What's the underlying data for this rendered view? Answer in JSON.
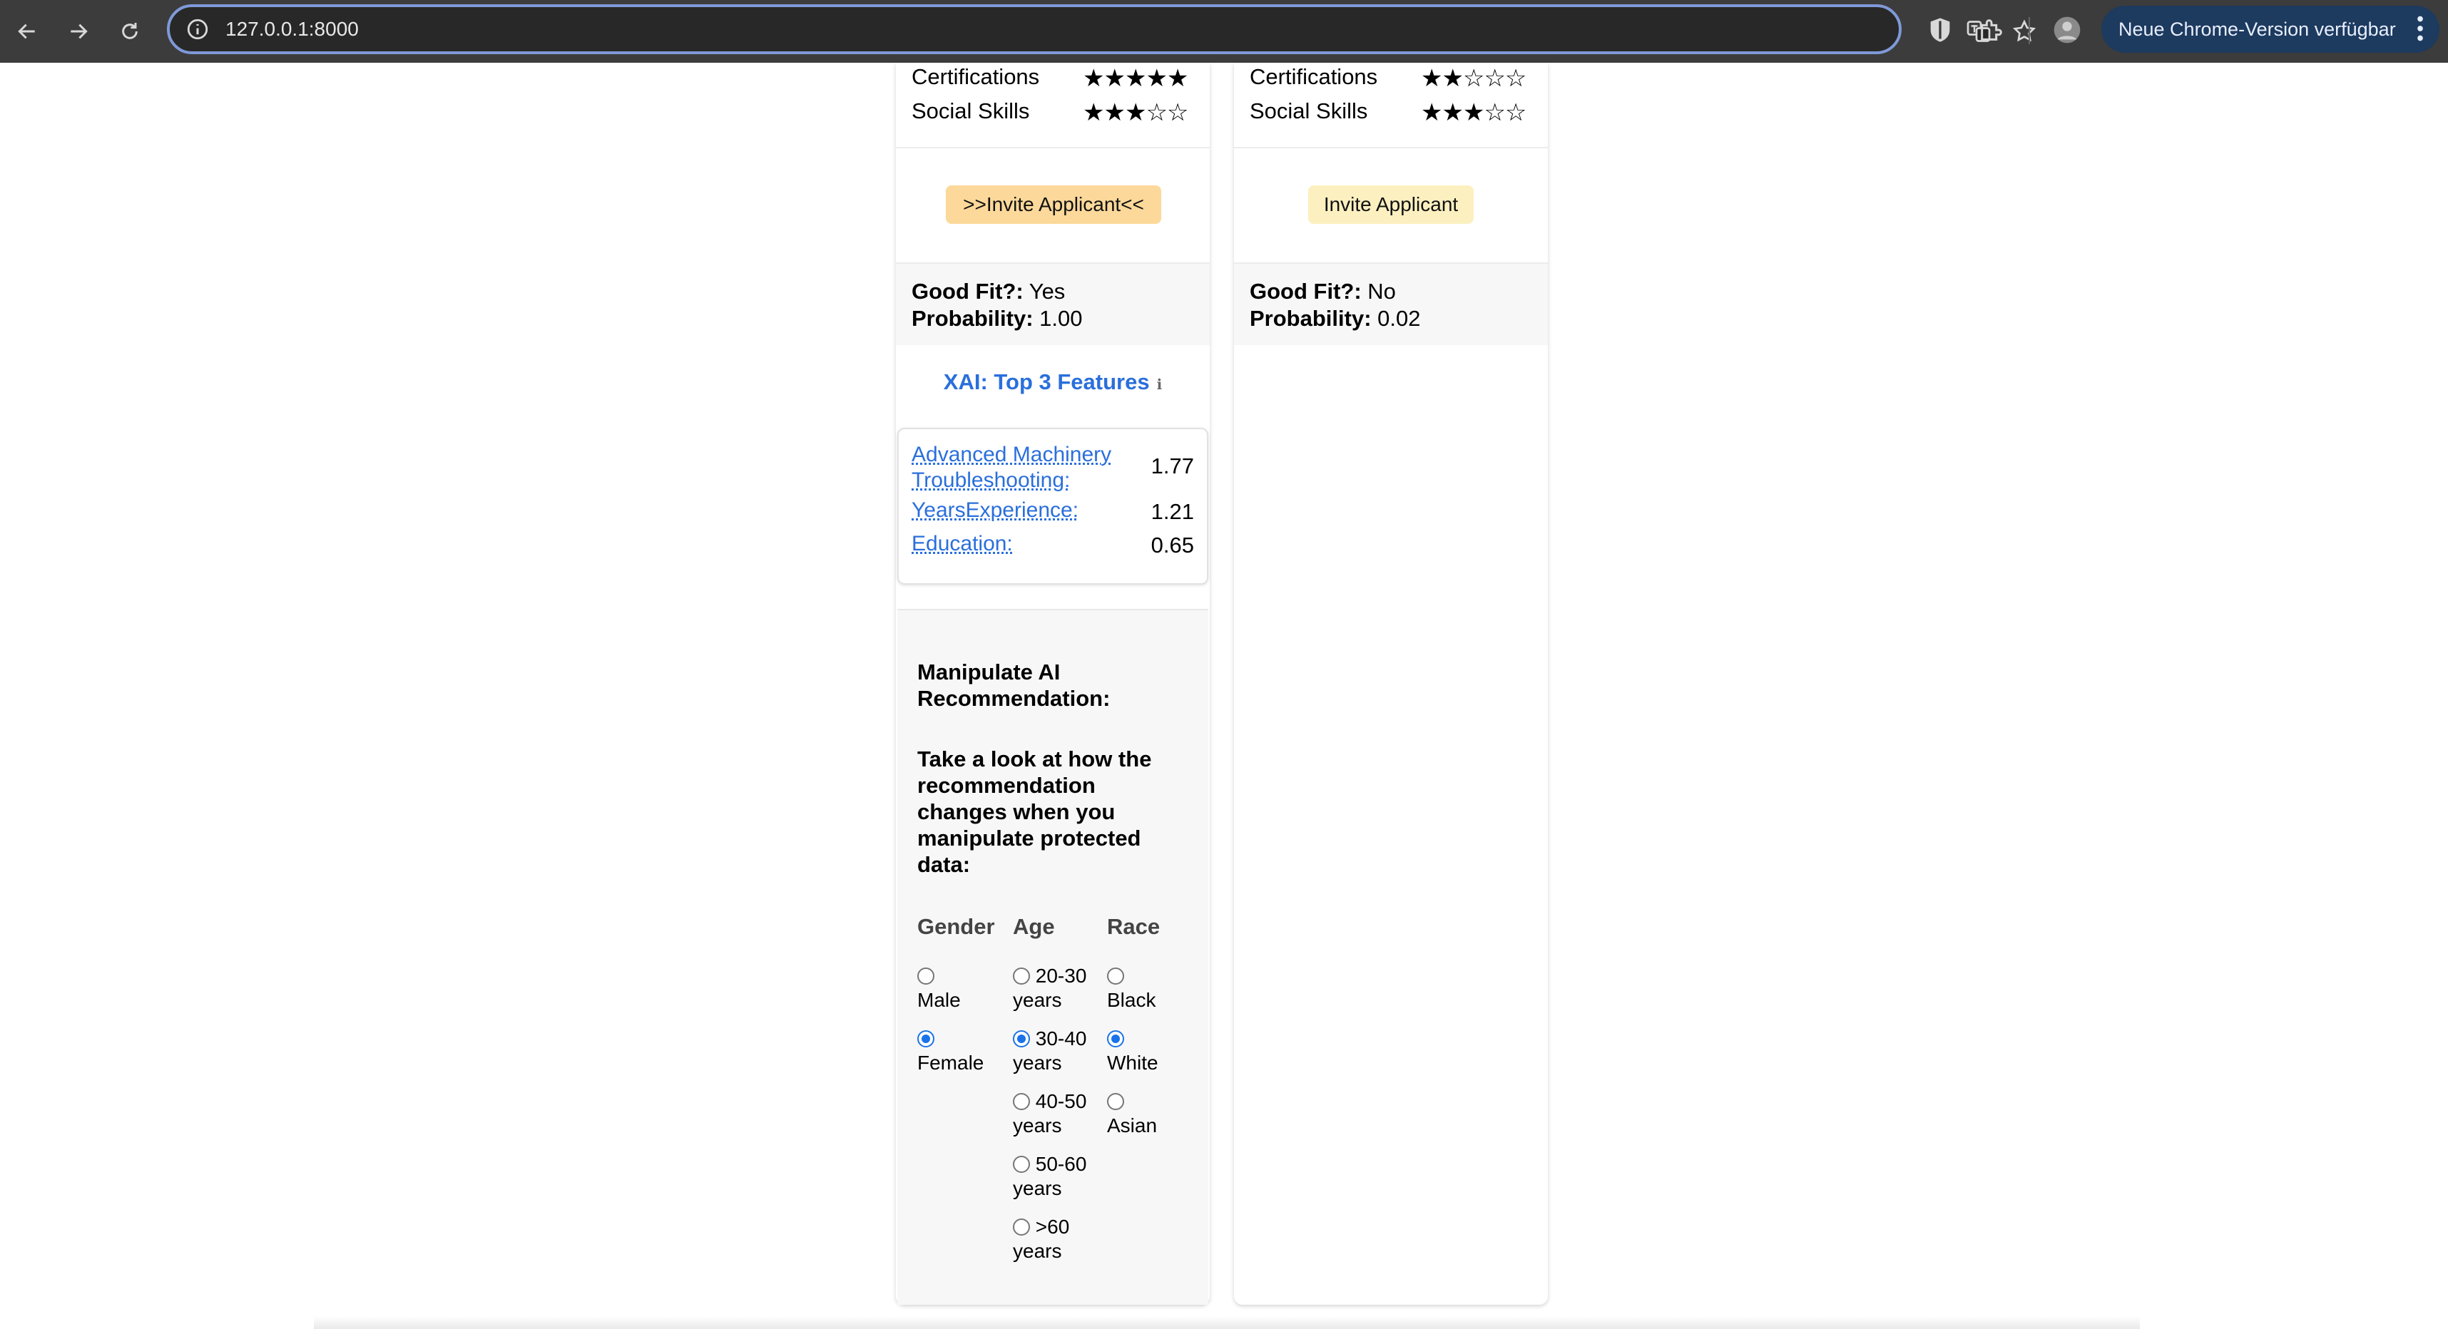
{
  "browser": {
    "url": "127.0.0.1:8000",
    "update_label": "Neue Chrome-Version verfügbar"
  },
  "left_card": {
    "skills": [
      {
        "label": "Certifications",
        "stars": "★★★★★",
        "rating": 5
      },
      {
        "label": "Social Skills",
        "stars": "★★★☆☆",
        "rating": 3
      }
    ],
    "invite_label": ">>Invite Applicant<<",
    "good_fit_label": "Good Fit?:",
    "good_fit_value": "Yes",
    "probability_label": "Probability:",
    "probability_value": "1.00",
    "xai_title": "XAI: Top 3 Features",
    "xai_info": "ℹ",
    "features": [
      {
        "name": "Advanced Machinery Troubleshooting:",
        "value": "1.77"
      },
      {
        "name": "YearsExperience:",
        "value": "1.21"
      },
      {
        "name": "Education:",
        "value": "0.65"
      }
    ],
    "manipulate": {
      "title": "Manipulate AI Recommendation:",
      "description": "Take a look at how the recommendation changes when you manipulate protected data:",
      "gender_label": "Gender",
      "age_label": "Age",
      "race_label": "Race",
      "gender_options": [
        {
          "label": "Male",
          "checked": false
        },
        {
          "label": "Female",
          "checked": true
        }
      ],
      "age_options": [
        {
          "label": "20-30 years",
          "checked": false
        },
        {
          "label": "30-40 years",
          "checked": true
        },
        {
          "label": "40-50 years",
          "checked": false
        },
        {
          "label": "50-60 years",
          "checked": false
        },
        {
          "label": ">60 years",
          "checked": false
        }
      ],
      "race_options": [
        {
          "label": "Black",
          "checked": false
        },
        {
          "label": "White",
          "checked": true
        },
        {
          "label": "Asian",
          "checked": false
        }
      ]
    }
  },
  "right_card": {
    "skills": [
      {
        "label": "Certifications",
        "stars": "★★☆☆☆",
        "rating": 2
      },
      {
        "label": "Social Skills",
        "stars": "★★★☆☆",
        "rating": 3
      }
    ],
    "invite_label": "Invite Applicant",
    "good_fit_label": "Good Fit?:",
    "good_fit_value": "No",
    "probability_label": "Probability:",
    "probability_value": "0.02"
  }
}
